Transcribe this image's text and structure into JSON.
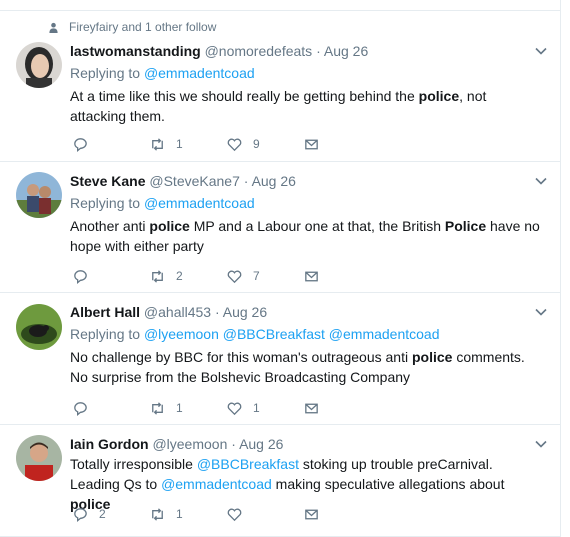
{
  "social_context": "Fireyfairy and 1 other follow",
  "tweets": [
    {
      "name": "lastwomanstanding",
      "handle": "@nomoredefeats",
      "date": "Aug 26",
      "replying_label": "Replying to",
      "mentions": [
        "@emmadentcoad"
      ],
      "text_parts": [
        "At a time like this we should really be getting behind the ",
        "police",
        ", not attacking them."
      ],
      "reply_count": "",
      "retweet_count": "1",
      "like_count": "9"
    },
    {
      "name": "Steve Kane",
      "handle": "@SteveKane7",
      "date": "Aug 26",
      "replying_label": "Replying to",
      "mentions": [
        "@emmadentcoad"
      ],
      "text_parts": [
        "Another anti ",
        "police",
        " MP and a Labour one at that, the British ",
        "Police",
        " have no hope with either party"
      ],
      "reply_count": "",
      "retweet_count": "2",
      "like_count": "7"
    },
    {
      "name": "Albert Hall",
      "handle": "@ahall453",
      "date": "Aug 26",
      "replying_label": "Replying to",
      "mentions": [
        "@lyeemoon",
        "@BBCBreakfast",
        "@emmadentcoad"
      ],
      "text_parts": [
        "No challenge by BBC for this woman's outrageous anti ",
        "police",
        " comments. No surprise from the Bolshevic Broadcasting Company"
      ],
      "reply_count": "",
      "retweet_count": "1",
      "like_count": "1"
    },
    {
      "name": "Iain Gordon",
      "handle": "@lyeemoon",
      "date": "Aug 26",
      "text_a": "Totally irresponsible ",
      "mention_a": "@BBCBreakfast",
      "text_b": " stoking up trouble preCarnival. Leading Qs to ",
      "mention_b": "@emmadentcoad",
      "text_c": " making speculative allegations about ",
      "text_d": "police",
      "reply_count": "2",
      "retweet_count": "1",
      "like_count": ""
    }
  ],
  "colors": {
    "link": "#1da1f2",
    "muted": "#657786",
    "border": "#e6ecf0"
  },
  "icons": [
    "person-icon",
    "reply-icon",
    "retweet-icon",
    "like-icon",
    "message-icon",
    "chevron-down-icon"
  ]
}
